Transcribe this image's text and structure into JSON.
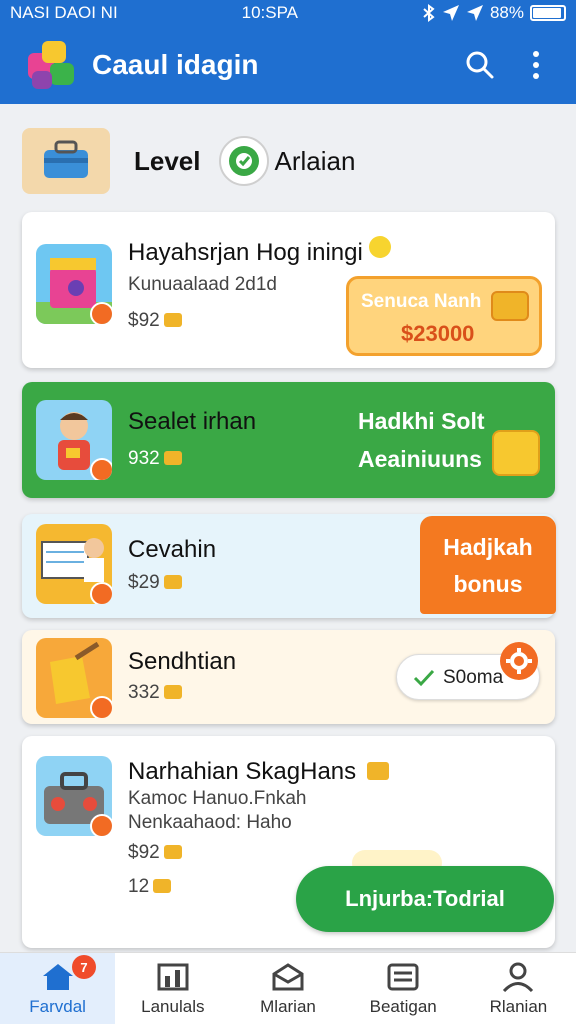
{
  "status_bar": {
    "carrier": "NASI DAOI NI",
    "time": "10:SPA",
    "battery": "88%",
    "battery_level": 0.88
  },
  "app_bar": {
    "title": "Caaul idagin",
    "icons": [
      "app-logo-icon",
      "search-icon",
      "more-vert-icon"
    ]
  },
  "level": {
    "label": "Level",
    "name": "Arlaian"
  },
  "cards": [
    {
      "title": "Hayahsrjan Hog iningi",
      "subtitle": "Kunuaalaad 2d1d",
      "price": "$92",
      "offer": {
        "label": "Senuca Nanh",
        "value": "$23000"
      }
    },
    {
      "title": "Sealet irhan",
      "price": "932",
      "right_line1": "Hadkhi Solt",
      "right_line2": "Aeainiuuns"
    },
    {
      "title": "Cevahin",
      "price": "$29",
      "ribbon_line1": "Hadjkah",
      "ribbon_line2": "bonus"
    },
    {
      "title": "Sendhtian",
      "price": "332",
      "chip": "S0oma"
    },
    {
      "title": "Narhahian SkagHans",
      "line1": "Kamoc Hanuo.Fnkah",
      "line2": "Nenkaahaod: Haho",
      "price": "$92",
      "price2": "12",
      "cta": "Lnjurba:Todrial"
    }
  ],
  "bottom_nav": [
    {
      "label": "Farvdal",
      "icon": "home-icon",
      "badge": "7"
    },
    {
      "label": "Lanulals",
      "icon": "chart-icon"
    },
    {
      "label": "Mlarian",
      "icon": "mail-icon"
    },
    {
      "label": "Beatigan",
      "icon": "list-icon"
    },
    {
      "label": "Rlanian",
      "icon": "profile-icon"
    }
  ],
  "colors": {
    "primary": "#1f6fd0",
    "green": "#3aa845",
    "orange": "#f47920",
    "offer_bg": "#ffd47d"
  }
}
